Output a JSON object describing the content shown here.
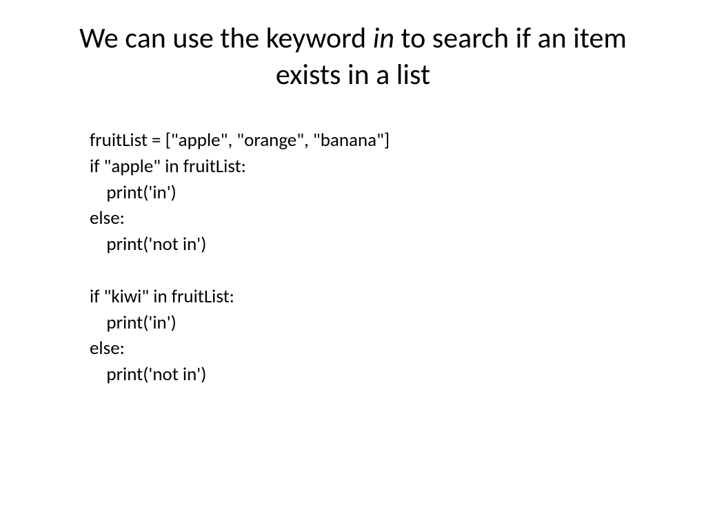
{
  "title": {
    "part1": "We can use the keyword ",
    "keyword": "in",
    "part2": " to search if an item exists in a list"
  },
  "code": {
    "line1": "fruitList = [\"apple\", \"orange\", \"banana\"]",
    "line2": "if \"apple\" in fruitList:",
    "line3": "    print('in')",
    "line4": "else:",
    "line5": "    print('not in')",
    "line6": "",
    "line7": "if \"kiwi\" in fruitList:",
    "line8": "    print('in')",
    "line9": "else:",
    "line10": "    print('not in')"
  }
}
